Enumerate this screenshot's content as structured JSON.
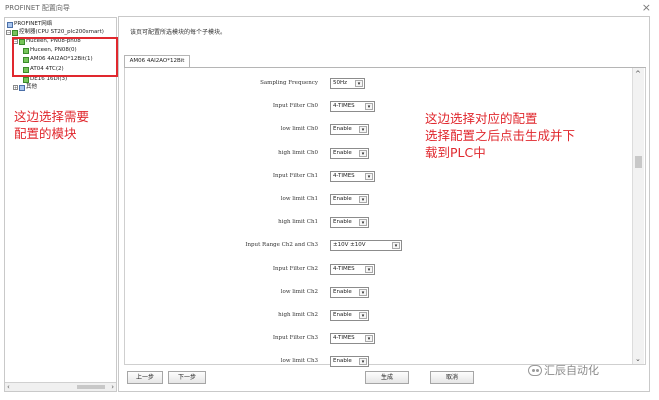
{
  "window": {
    "title": "PROFINET 配置向导",
    "close_glyph": "×"
  },
  "tree": {
    "root": "PROFINET网络",
    "controller": "控制器(CPU ST20_plc200smart)",
    "device": "Huceen, PN08-pn08",
    "items": [
      "Huceen, PN08(0)",
      "AM06 4AI2AO*12Bit(1)",
      "AT04 4TC(2)",
      "DE16 16DI(3)"
    ],
    "other": "其他"
  },
  "annotations": {
    "left_line1": "这边选择需要",
    "left_line2": "配置的模块",
    "right_line1": "这边选择对应的配置",
    "right_line2": "选择配置之后点击生成并下",
    "right_line3": "载到PLC中"
  },
  "main": {
    "info": "该页可配置所选模块的每个子模块。",
    "tab": "AM06 4AI2AO*12Bit",
    "params": [
      {
        "label": "Sampling Frequency",
        "value": "50Hz"
      },
      {
        "label": "Input Filter Ch0",
        "value": "4-TIMES"
      },
      {
        "label": "low limit Ch0",
        "value": "Enable"
      },
      {
        "label": "high limit Ch0",
        "value": "Enable"
      },
      {
        "label": "Input Filter Ch1",
        "value": "4-TIMES"
      },
      {
        "label": "low limit Ch1",
        "value": "Enable"
      },
      {
        "label": "high limit Ch1",
        "value": "Enable"
      },
      {
        "label": "Input Range Ch2 and Ch3",
        "value": "±10V  ±10V"
      },
      {
        "label": "Input Filter Ch2",
        "value": "4-TIMES"
      },
      {
        "label": "low limit Ch2",
        "value": "Enable"
      },
      {
        "label": "high limit Ch2",
        "value": "Enable"
      },
      {
        "label": "Input Filter Ch3",
        "value": "4-TIMES"
      },
      {
        "label": "low limit Ch3",
        "value": "Enable"
      }
    ]
  },
  "buttons": {
    "prev": "上一步",
    "next": "下一步",
    "generate": "生成",
    "cancel": "取消"
  },
  "watermark": "汇辰自动化",
  "colors": {
    "annotation": "#e0282e",
    "tree_icon": "#77c45a"
  }
}
